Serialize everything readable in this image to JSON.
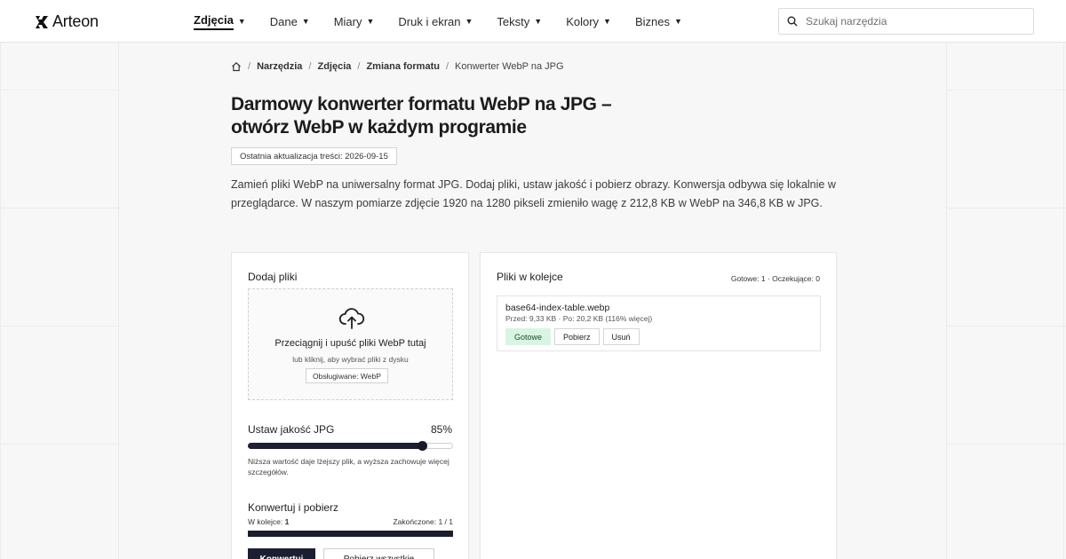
{
  "header": {
    "logo_text": "Arteon",
    "nav": [
      {
        "label": "Zdjęcia",
        "active": true
      },
      {
        "label": "Dane",
        "active": false
      },
      {
        "label": "Miary",
        "active": false
      },
      {
        "label": "Druk i ekran",
        "active": false
      },
      {
        "label": "Teksty",
        "active": false
      },
      {
        "label": "Kolory",
        "active": false
      },
      {
        "label": "Biznes",
        "active": false
      }
    ],
    "search_placeholder": "Szukaj narzędzia"
  },
  "breadcrumb": {
    "items": [
      "Narzędzia",
      "Zdjęcia",
      "Zmiana formatu"
    ],
    "current": "Konwerter WebP na JPG",
    "separator": "/"
  },
  "page": {
    "title": "Darmowy konwerter formatu WebP na JPG – otwórz WebP w każdym programie",
    "updated": "Ostatnia aktualizacja treści: 2026-09-15",
    "intro": "Zamień pliki WebP na uniwersalny format JPG. Dodaj pliki, ustaw jakość i pobierz obrazy. Konwersja odbywa się lokalnie w przeglądarce. W naszym pomiarze zdjęcie 1920 na 1280 pikseli zmieniło wagę z 212,8 KB w WebP na 346,8 KB w JPG."
  },
  "upload": {
    "title": "Dodaj pliki",
    "drop_title": "Przeciągnij i upuść pliki WebP tutaj",
    "drop_sub": "lub kliknij, aby wybrać pliki z dysku",
    "supported": "Obsługiwane: WebP"
  },
  "quality": {
    "label": "Ustaw jakość JPG",
    "value_text": "85%",
    "value": 85,
    "hint": "Niższa wartość daje lżejszy plik, a wyższa zachowuje więcej szczegółów."
  },
  "convert": {
    "title": "Konwertuj i pobierz",
    "queue_label": "W kolejce:",
    "queue_count": "1",
    "done_text": "Zakończone: 1 / 1",
    "progress": 1.0,
    "primary_button": "Konwertuj",
    "secondary_button": "Pobierz wszystkie"
  },
  "queue": {
    "title": "Pliki w kolejce",
    "stats": "Gotowe: 1 · Oczekujące: 0",
    "files": [
      {
        "name": "base64-index-table.webp",
        "meta": "Przed: 9,33 KB · Po: 20,2 KB (116% więcej)",
        "status": "Gotowe",
        "download": "Pobierz",
        "remove": "Usuń"
      }
    ]
  },
  "colors": {
    "accent_dark": "#1c1f30",
    "status_ok_bg": "#d8f5e3"
  }
}
